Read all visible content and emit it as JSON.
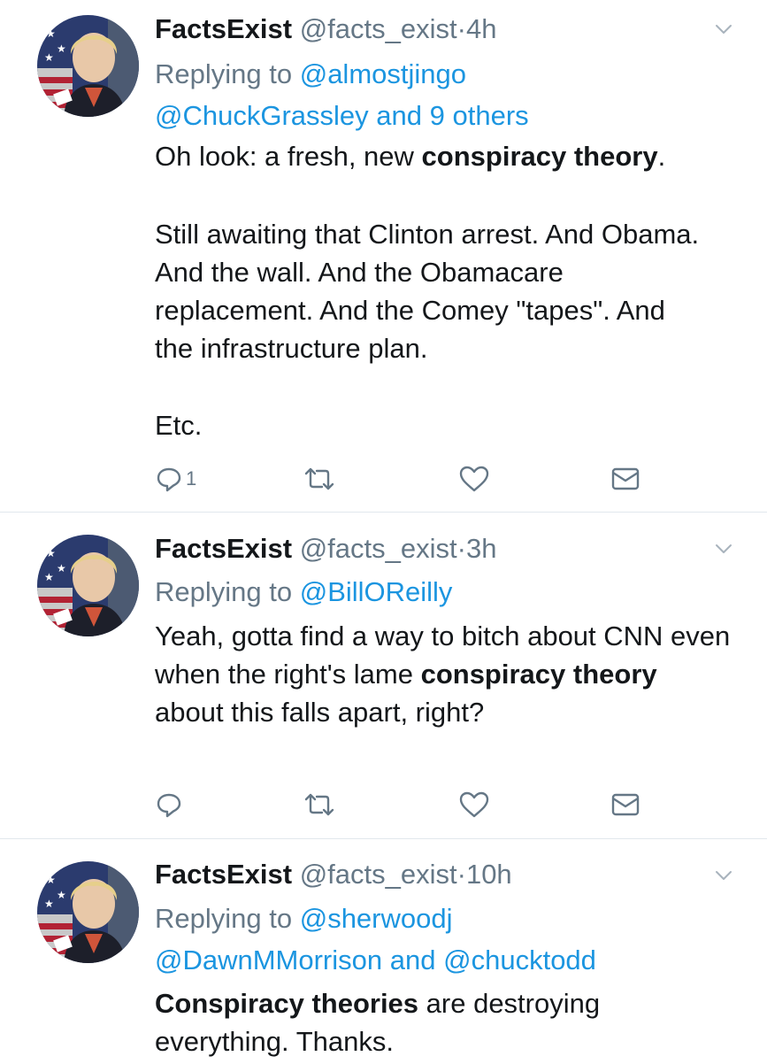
{
  "colors": {
    "link": "#1b95e0",
    "secondary": "#657786",
    "text": "#14171a",
    "divider": "#e1e8ed"
  },
  "icons": {
    "reply": "reply-icon",
    "retweet": "retweet-icon",
    "like": "heart-icon",
    "message": "envelope-icon",
    "menu": "chevron-down-icon"
  },
  "tweets": [
    {
      "name": "FactsExist",
      "handle": "@facts_exist",
      "separator": "·",
      "time": "4h",
      "reply_prefix": "Replying to",
      "reply_line1": "@almostjingo",
      "reply_line2_a": "@ChuckGrassley",
      "reply_line2_and": "and",
      "reply_line2_b": "9 others",
      "body_p1_before": "Oh look: a fresh, new ",
      "body_p1_bold": "conspiracy theory",
      "body_p1_after": ".",
      "body_p2": "Still awaiting that Clinton arrest. And Obama. And the wall. And the Obamacare replacement. And the Comey \"tapes\". And the infrastructure plan.",
      "body_p3": "Etc.",
      "reply_count": "1"
    },
    {
      "name": "FactsExist",
      "handle": "@facts_exist",
      "separator": "·",
      "time": "3h",
      "reply_prefix": "Replying to",
      "reply_line1": "@BillOReilly",
      "body_before": "Yeah, gotta find a way to bitch about CNN even when the right's lame ",
      "body_bold": "conspiracy theory",
      "body_after": " about this falls apart, right?",
      "reply_count": ""
    },
    {
      "name": "FactsExist",
      "handle": "@facts_exist",
      "separator": "·",
      "time": "10h",
      "reply_prefix": "Replying to",
      "reply_line1": "@sherwoodj",
      "reply_line2_a": "@DawnMMorrison",
      "reply_line2_and": "and",
      "reply_line2_b": "@chucktodd",
      "body_bold": "Conspiracy theories",
      "body_after": " are destroying everything. Thanks."
    }
  ]
}
